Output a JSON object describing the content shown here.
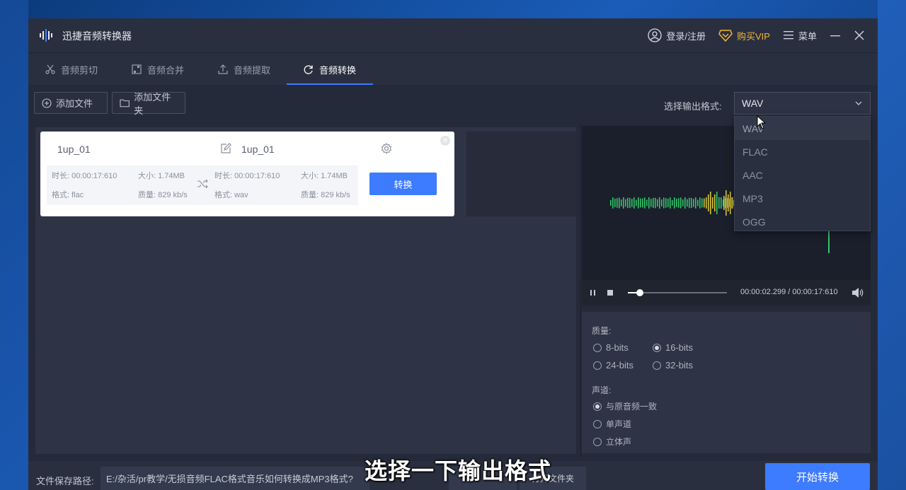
{
  "app": {
    "title": "迅捷音频转换器",
    "login": "登录/注册",
    "vip": "购买VIP",
    "menu": "菜单"
  },
  "tabs": [
    {
      "label": "音频剪切",
      "icon": "scissors-icon"
    },
    {
      "label": "音频合并",
      "icon": "merge-icon"
    },
    {
      "label": "音频提取",
      "icon": "upload-icon"
    },
    {
      "label": "音频转换",
      "icon": "refresh-icon",
      "active": true
    }
  ],
  "toolbar": {
    "add_file": "添加文件",
    "add_folder": "添加文件夹",
    "format_label": "选择输出格式:",
    "format_value": "WAV"
  },
  "dropdown": {
    "options": [
      "WAV",
      "FLAC",
      "AAC",
      "MP3",
      "OGG"
    ]
  },
  "file_card": {
    "source_name": "1up_01",
    "target_name": "1up_01",
    "source": {
      "duration": "时长:  00:00:17:610",
      "size": "大小:  1.74MB",
      "format": "格式:  flac",
      "quality": "质量:  829 kb/s"
    },
    "target": {
      "duration": "时长:  00:00:17:610",
      "size": "大小:  1.74MB",
      "format": "格式:  wav",
      "quality": "质量:  829 kb/s"
    },
    "convert_label": "转换"
  },
  "player": {
    "time": "00:00:02.299 / 00:00:17:610",
    "progress": 0.12
  },
  "settings": {
    "quality_label": "质量:",
    "quality_options": [
      "8-bits",
      "16-bits",
      "24-bits",
      "32-bits"
    ],
    "quality_selected": "16-bits",
    "channel_label": "声道:",
    "channel_options": [
      "与原音频一致",
      "单声道",
      "立体声"
    ],
    "channel_selected": "与原音频一致"
  },
  "bottom": {
    "path_label": "文件保存路径:",
    "path_value": "E:/杂活/pr教学/无损音频FLAC格式音乐如何转换成MP3格式?",
    "open_folder": "打开文件夹",
    "start": "开始转换"
  },
  "subtitle": "选择一下输出格式",
  "colors": {
    "accent": "#3d7bff",
    "vip": "#f2b632",
    "wave_green": "#35c46a",
    "wave_yellow": "#d4c23a"
  }
}
